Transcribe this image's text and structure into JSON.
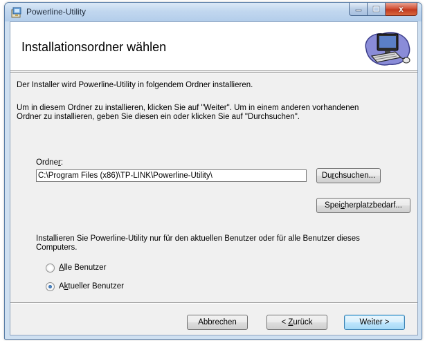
{
  "window": {
    "title": "Powerline-Utility",
    "close_glyph": "x"
  },
  "banner": {
    "title": "Installationsordner wählen",
    "icon": "computer-setup-icon"
  },
  "body": {
    "intro": "Der Installer wird Powerline-Utility in folgendem Ordner installieren.",
    "instruction_line1": "Um in diesem Ordner zu installieren, klicken Sie auf \"Weiter\". Um in einem anderen vorhandenen",
    "instruction_line2": "Ordner zu installieren, geben Sie diesen ein oder klicken Sie auf \"Durchsuchen\"."
  },
  "folder": {
    "label_prefix": "Ordne",
    "label_mnemonic": "r",
    "label_suffix": ":",
    "value": "C:\\Program Files (x86)\\TP-LINK\\Powerline-Utility\\"
  },
  "buttons": {
    "browse": {
      "prefix": "Du",
      "mnemonic": "r",
      "suffix": "chsuchen..."
    },
    "disk_cost": {
      "prefix": "Spei",
      "mnemonic": "c",
      "suffix": "herplatzbedarf..."
    },
    "cancel": "Abbrechen",
    "back": {
      "prefix": "< ",
      "mnemonic": "Z",
      "suffix": "urück"
    },
    "next": "Weiter >"
  },
  "users": {
    "question_line1": "Installieren Sie Powerline-Utility nur für den aktuellen Benutzer oder für alle Benutzer dieses",
    "question_line2": "Computers.",
    "all": {
      "mnemonic": "A",
      "suffix": "lle Benutzer",
      "checked": false
    },
    "current": {
      "prefix": "A",
      "mnemonic": "k",
      "suffix": "tueller Benutzer",
      "checked": true
    }
  }
}
